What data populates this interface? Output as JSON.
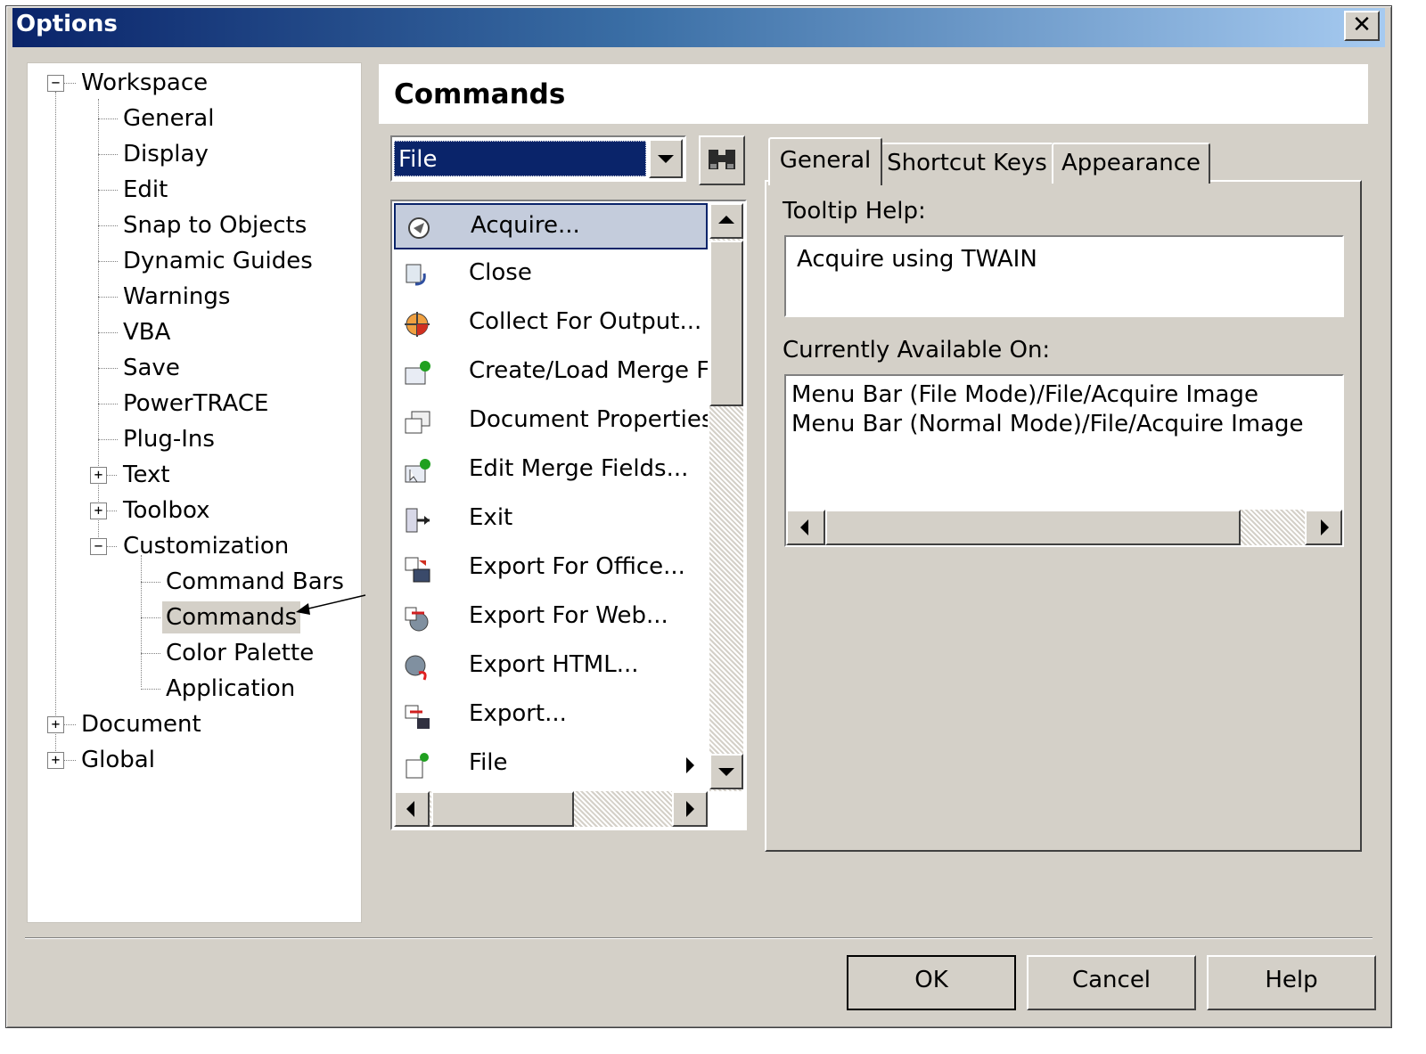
{
  "window": {
    "title": "Options",
    "close_glyph": "✕"
  },
  "tree": {
    "items": [
      {
        "label": "Workspace",
        "toggle": "−"
      },
      {
        "label": "General"
      },
      {
        "label": "Display"
      },
      {
        "label": "Edit"
      },
      {
        "label": "Snap to Objects"
      },
      {
        "label": "Dynamic Guides"
      },
      {
        "label": "Warnings"
      },
      {
        "label": "VBA"
      },
      {
        "label": "Save"
      },
      {
        "label": "PowerTRACE"
      },
      {
        "label": "Plug-Ins"
      },
      {
        "label": "Text",
        "toggle": "+"
      },
      {
        "label": "Toolbox",
        "toggle": "+"
      },
      {
        "label": "Customization",
        "toggle": "−"
      },
      {
        "label": "Command Bars"
      },
      {
        "label": "Commands",
        "selected": true
      },
      {
        "label": "Color Palette"
      },
      {
        "label": "Application"
      },
      {
        "label": "Document",
        "toggle": "+"
      },
      {
        "label": "Global",
        "toggle": "+"
      }
    ]
  },
  "header": {
    "title": "Commands"
  },
  "category": {
    "selected": "File"
  },
  "commands": {
    "items": [
      {
        "label": "Acquire...",
        "icon": "acquire-icon",
        "selected": true
      },
      {
        "label": "Close",
        "icon": "close-doc-icon"
      },
      {
        "label": "Collect For Output...",
        "icon": "collect-output-icon"
      },
      {
        "label": "Create/Load Merge Fie",
        "icon": "merge-create-icon"
      },
      {
        "label": "Document Properties...",
        "icon": "document-properties-icon"
      },
      {
        "label": "Edit Merge Fields...",
        "icon": "edit-merge-icon"
      },
      {
        "label": "Exit",
        "icon": "exit-icon"
      },
      {
        "label": "Export For Office...",
        "icon": "export-office-icon"
      },
      {
        "label": "Export For Web...",
        "icon": "export-web-icon"
      },
      {
        "label": "Export HTML...",
        "icon": "export-html-icon"
      },
      {
        "label": "Export...",
        "icon": "export-icon"
      },
      {
        "label": "File",
        "icon": "file-icon",
        "submenu": true
      }
    ]
  },
  "tabs": [
    {
      "label": "General",
      "active": true
    },
    {
      "label": "Shortcut Keys"
    },
    {
      "label": "Appearance"
    }
  ],
  "general": {
    "tooltip_label": "Tooltip Help:",
    "tooltip_value": "Acquire using TWAIN",
    "available_label": "Currently Available On:",
    "available_lines": [
      "Menu Bar (File Mode)/File/Acquire Image",
      "Menu Bar (Normal Mode)/File/Acquire Image"
    ]
  },
  "buttons": {
    "ok": "OK",
    "cancel": "Cancel",
    "help": "Help"
  },
  "colors": {
    "titlebar_start": "#0a246a",
    "titlebar_end": "#a6caf0",
    "selection": "#0a246a",
    "face": "#d4d0c8"
  }
}
